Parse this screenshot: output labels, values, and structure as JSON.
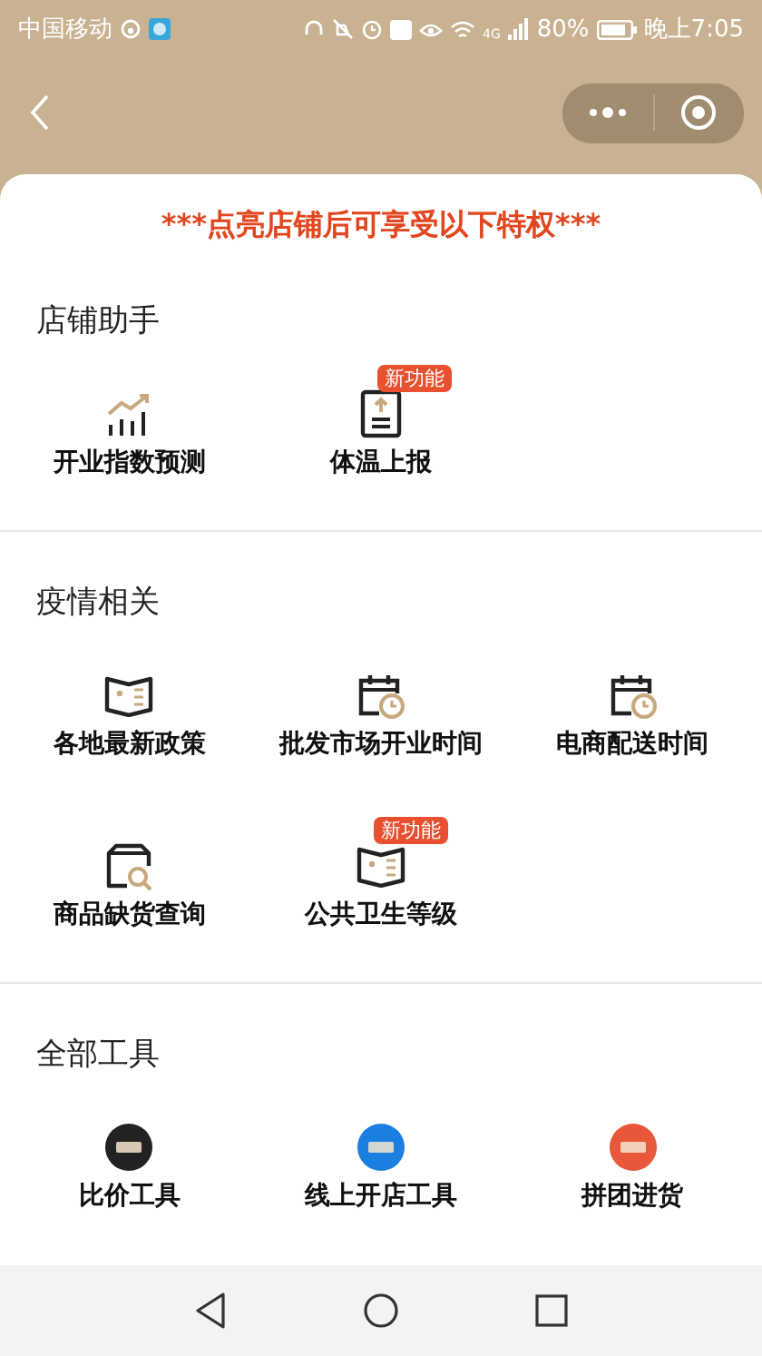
{
  "status_bar": {
    "carrier": "中国移动",
    "network": "4G",
    "battery": "80%",
    "time": "晚上7:05"
  },
  "banner": "***点亮店铺后可享受以下特权***",
  "sections": [
    {
      "title": "店铺助手",
      "items": [
        {
          "label": "开业指数预测",
          "kind": "chart"
        },
        {
          "label": "体温上报",
          "kind": "report",
          "badge": "新功能"
        }
      ]
    },
    {
      "title": "疫情相关",
      "items": [
        {
          "label": "各地最新政策",
          "kind": "book"
        },
        {
          "label": "批发市场开业时间",
          "kind": "calendar"
        },
        {
          "label": "电商配送时间",
          "kind": "calendar"
        },
        {
          "label": "商品缺货查询",
          "kind": "search-box"
        },
        {
          "label": "公共卫生等级",
          "kind": "book",
          "badge": "新功能"
        }
      ]
    },
    {
      "title": "全部工具",
      "items": [
        {
          "label": "比价工具",
          "kind": "logo",
          "color": "#222222"
        },
        {
          "label": "线上开店工具",
          "kind": "logo",
          "color": "#1a7fe0"
        },
        {
          "label": "拼团进货",
          "kind": "logo",
          "color": "#e8573a"
        }
      ]
    }
  ]
}
